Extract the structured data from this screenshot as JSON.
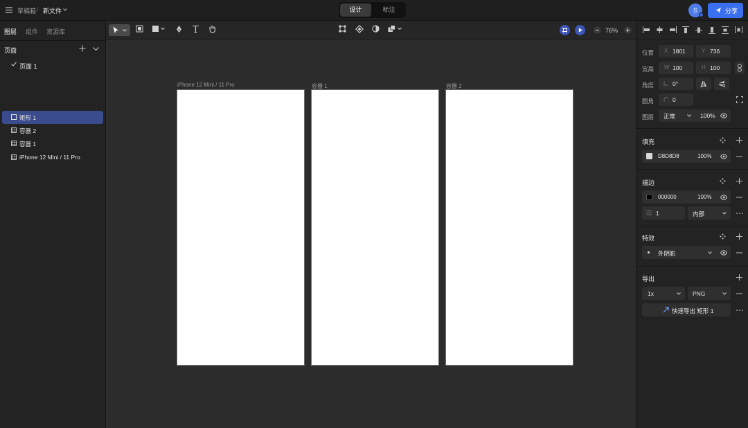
{
  "topbar": {
    "breadcrumb_drafts": "草稿箱",
    "breadcrumb_sep": "/",
    "file_name": "新文件",
    "mode_design": "设计",
    "mode_annotate": "标注",
    "avatar_initial": "S",
    "share_label": "分享"
  },
  "left_panel": {
    "tabs": [
      "图层",
      "组件",
      "资源库"
    ],
    "pages_title": "页面",
    "pages": [
      {
        "label": "页面 1",
        "active": true
      }
    ],
    "layers": [
      {
        "label": "矩形 1",
        "selected": true,
        "icon": "rectangle-icon"
      },
      {
        "label": "容器 2",
        "selected": false,
        "icon": "frame-icon"
      },
      {
        "label": "容器 1",
        "selected": false,
        "icon": "frame-icon"
      },
      {
        "label": "iPhone 12 Mini / 11 Pro",
        "selected": false,
        "icon": "frame-icon"
      }
    ]
  },
  "toolbar": {
    "zoom_level": "76%"
  },
  "canvas": {
    "frames": [
      {
        "label": "iPhone 12 Mini / 11 Pro"
      },
      {
        "label": "容器 1"
      },
      {
        "label": "容器 2"
      }
    ],
    "help_label": "?"
  },
  "right_panel": {
    "position": {
      "label": "位置",
      "x_prefix": "X",
      "x": "1801",
      "y_prefix": "Y",
      "y": "736"
    },
    "size": {
      "label": "宽高",
      "w_prefix": "W",
      "w": "100",
      "h_prefix": "H",
      "h": "100"
    },
    "rotation": {
      "label": "角度",
      "value": "0°"
    },
    "radius": {
      "label": "圆角",
      "value": "0"
    },
    "layer": {
      "label": "图层",
      "blend": "正常",
      "opacity": "100%"
    },
    "fill": {
      "title": "填充",
      "hex": "D8D8D8",
      "opacity": "100%",
      "color": "#D8D8D8"
    },
    "stroke": {
      "title": "描边",
      "hex": "000000",
      "opacity": "100%",
      "color": "#000000",
      "width": "1",
      "position": "内部"
    },
    "effects": {
      "title": "特效",
      "effect": "外阴影"
    },
    "export": {
      "title": "导出",
      "scale": "1x",
      "format": "PNG",
      "quick_export": "快速导出 矩形 1"
    }
  },
  "colors": {
    "accent": "#3a6ff0",
    "selection": "#3a4b8e",
    "panel": "#232323",
    "canvas": "#2c2c2c"
  }
}
